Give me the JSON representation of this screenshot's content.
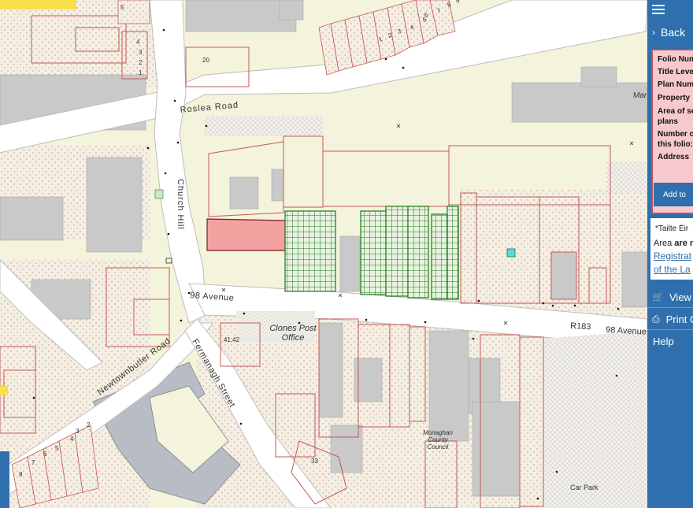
{
  "map": {
    "streets": {
      "roslea_road": "Roslea Road",
      "church_hill": "Church Hill",
      "avenue_98_west": "98 Avenue",
      "avenue_98_east": "98 Avenue",
      "route": "R183",
      "newtownbutler_road": "Newtownbutler Road",
      "fermanagh_street": "Fermanagh Street"
    },
    "places": {
      "clones_post_office": "Clones Post Office",
      "monaghan_county_council": "Monaghan County Council",
      "car_park": "Car Park",
      "mar_partial": "Mar"
    },
    "house_numbers": {
      "top_row": [
        "1",
        "2",
        "3",
        "4",
        "5",
        "6",
        "7",
        "8",
        "9"
      ],
      "left_stack": [
        "4",
        "3",
        "2",
        "1"
      ],
      "n20": "20",
      "n5": "5",
      "n41_42": "41,42",
      "n33": "33",
      "bottom_left_row": [
        "8",
        "7",
        "6",
        "5",
        "4",
        "3",
        "2"
      ]
    },
    "colors": {
      "highlight_fill": "#f3a1a1",
      "highlight_stroke": "#7a1f1f",
      "green_hatch": "#1b7a1b",
      "road": "#ffffff",
      "parcel": "#c25a5a",
      "building": "#c9c9c9",
      "land": "#f4f3dc"
    }
  },
  "panel": {
    "menu_icon": "hamburger-icon",
    "back_label": "Back",
    "fields": [
      "Folio Num",
      "Title Leve",
      "Plan Num",
      "Property",
      "Area of se",
      "plans",
      "Number o",
      "this folio:",
      "Address"
    ],
    "add_button": "Add to",
    "note": {
      "line1": "*Tailte Éir",
      "line2_prefix": "Area ",
      "line2_bold": "are n",
      "link1": "Registrat",
      "link2": "of the La"
    },
    "view_label": "View b",
    "view_icon": "cart-icon",
    "print_label": "Print C",
    "print_icon": "printer-icon",
    "help_label": "Help"
  }
}
